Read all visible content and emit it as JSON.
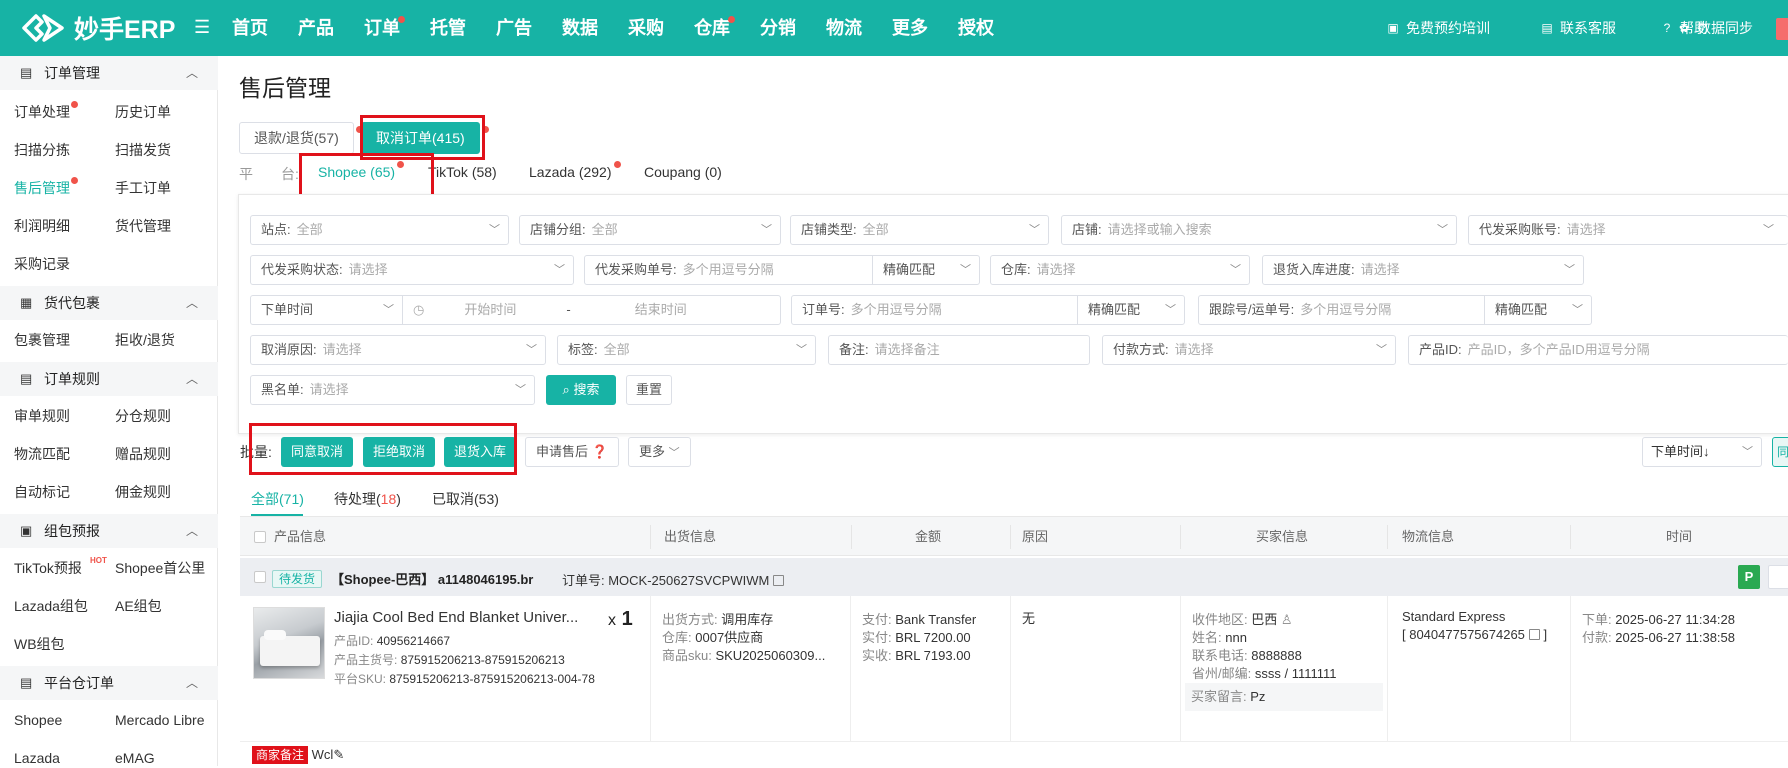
{
  "header": {
    "logo_text": "妙手ERP",
    "nav": [
      {
        "label": "首页",
        "dot": false
      },
      {
        "label": "产品",
        "dot": false
      },
      {
        "label": "订单",
        "dot": true
      },
      {
        "label": "托管",
        "dot": false
      },
      {
        "label": "广告",
        "dot": false
      },
      {
        "label": "数据",
        "dot": false
      },
      {
        "label": "采购",
        "dot": false
      },
      {
        "label": "仓库",
        "dot": true
      },
      {
        "label": "分销",
        "dot": false
      },
      {
        "label": "物流",
        "dot": false
      },
      {
        "label": "更多",
        "dot": false
      },
      {
        "label": "授权",
        "dot": false
      }
    ],
    "tools": {
      "training": "免费预约培训",
      "support": "联系客服",
      "help": "帮助",
      "sync": "数据同步"
    }
  },
  "sidebar": {
    "sections": [
      {
        "title": "订单管理",
        "items": [
          "订单处理",
          "历史订单",
          "扫描分拣",
          "扫描发货",
          "售后管理",
          "手工订单",
          "利润明细",
          "货代管理",
          "采购记录"
        ]
      },
      {
        "title": "货代包裹",
        "items": [
          "包裹管理",
          "拒收/退货"
        ]
      },
      {
        "title": "订单规则",
        "items": [
          "审单规则",
          "分仓规则",
          "物流匹配",
          "赠品规则",
          "自动标记",
          "佣金规则"
        ]
      },
      {
        "title": "组包预报",
        "items": [
          "TikTok预报",
          "Shopee首公里",
          "Lazada组包",
          "AE组包",
          "WB组包"
        ],
        "hot": "HOT"
      },
      {
        "title": "平台仓订单",
        "items": [
          "Shopee",
          "Mercado Libre",
          "Lazada",
          "eMAG"
        ]
      }
    ]
  },
  "main": {
    "title": "售后管理",
    "tabs": [
      "退款/退货(57)",
      "取消订单(415)"
    ],
    "platform_label": "平　　台:",
    "platforms": [
      "Shopee (65)",
      "TikTok (58)",
      "Lazada (292)",
      "Coupang (0)"
    ],
    "filters": {
      "site": {
        "label": "站点:",
        "value": "全部"
      },
      "shop_group": {
        "label": "店铺分组:",
        "value": "全部"
      },
      "shop_type": {
        "label": "店铺类型:",
        "value": "全部"
      },
      "shop": {
        "label": "店铺:",
        "placeholder": "请选择或输入搜索"
      },
      "dropship_account": {
        "label": "代发采购账号:",
        "placeholder": "请选择"
      },
      "dropship_status": {
        "label": "代发采购状态:",
        "placeholder": "请选择"
      },
      "dropship_no": {
        "label": "代发采购单号:",
        "placeholder": "多个用逗号分隔"
      },
      "match1": "精确匹配",
      "warehouse": {
        "label": "仓库:",
        "placeholder": "请选择"
      },
      "return_progress": {
        "label": "退货入库进度:",
        "placeholder": "请选择"
      },
      "time_type": "下单时间",
      "start_time": "开始时间",
      "range_sep": "-",
      "end_time": "结束时间",
      "order_no": {
        "label": "订单号:",
        "placeholder": "多个用逗号分隔"
      },
      "match2": "精确匹配",
      "tracking_no": {
        "label": "跟踪号/运单号:",
        "placeholder": "多个用逗号分隔"
      },
      "match3": "精确匹配",
      "cancel_reason": {
        "label": "取消原因:",
        "placeholder": "请选择"
      },
      "tag": {
        "label": "标签:",
        "value": "全部"
      },
      "note": {
        "label": "备注:",
        "placeholder": "请选择备注"
      },
      "payment": {
        "label": "付款方式:",
        "placeholder": "请选择"
      },
      "product_id": {
        "label": "产品ID:",
        "placeholder": "产品ID，多个产品ID用逗号分隔"
      },
      "blacklist": {
        "label": "黑名单:",
        "placeholder": "请选择"
      },
      "search": "搜索",
      "reset": "重置"
    },
    "batch": {
      "label": "批量:",
      "agree": "同意取消",
      "reject": "拒绝取消",
      "return_in": "退货入库",
      "apply": "申请售后",
      "more": "更多",
      "sort": "下单时间↓",
      "edge": "同"
    },
    "subtabs": {
      "all": "全部(71)",
      "pending_label": "待处理(",
      "pending_num": "18",
      "pending_close": ")",
      "cancelled": "已取消(53)"
    },
    "columns": [
      "产品信息",
      "出货信息",
      "金额",
      "原因",
      "买家信息",
      "物流信息",
      "时间"
    ],
    "order": {
      "status": "待发货",
      "shop": "【Shopee-巴西】 a1148046195.br",
      "order_no": "订单号: MOCK-250627SVCPWIWM",
      "p_btn": "P",
      "product_title": "Jiajia Cool Bed End Blanket Univer...",
      "qty_x": "x",
      "qty": "1",
      "product_id_label": "产品ID:",
      "product_id": "40956214667",
      "main_sku_label": "产品主货号:",
      "main_sku": "875915206213-875915206213",
      "platform_sku_label": "平台SKU:",
      "platform_sku": "875915206213-875915206213-004-78",
      "ship_method_label": "出货方式:",
      "ship_method": "调用库存",
      "warehouse_label": "仓库:",
      "warehouse": "0007供应商",
      "sku_label": "商品sku:",
      "sku": "SKU2025060309...",
      "pay_label": "支付:",
      "pay": "Bank Transfer",
      "paid_label": "实付:",
      "paid": "BRL 7200.00",
      "received_label": "实收:",
      "received": "BRL 7193.00",
      "reason": "无",
      "region_label": "收件地区:",
      "region": "巴西",
      "name_label": "姓名:",
      "name": "nnn",
      "phone_label": "联系电话:",
      "phone": "8888888",
      "province_label": "省州/邮编:",
      "province": "ssss / 1111111",
      "buyer_msg_label": "买家留言:",
      "buyer_msg": "Pz",
      "logistics": "Standard Express",
      "tracking": "[ 8040477575674265",
      "tracking_close": "]",
      "order_time_label": "下单:",
      "order_time": "2025-06-27 11:34:28",
      "pay_time_label": "付款:",
      "pay_time": "2025-06-27 11:38:58",
      "merchant_note_label": "商家备注",
      "merchant_note": "Wcl"
    }
  }
}
